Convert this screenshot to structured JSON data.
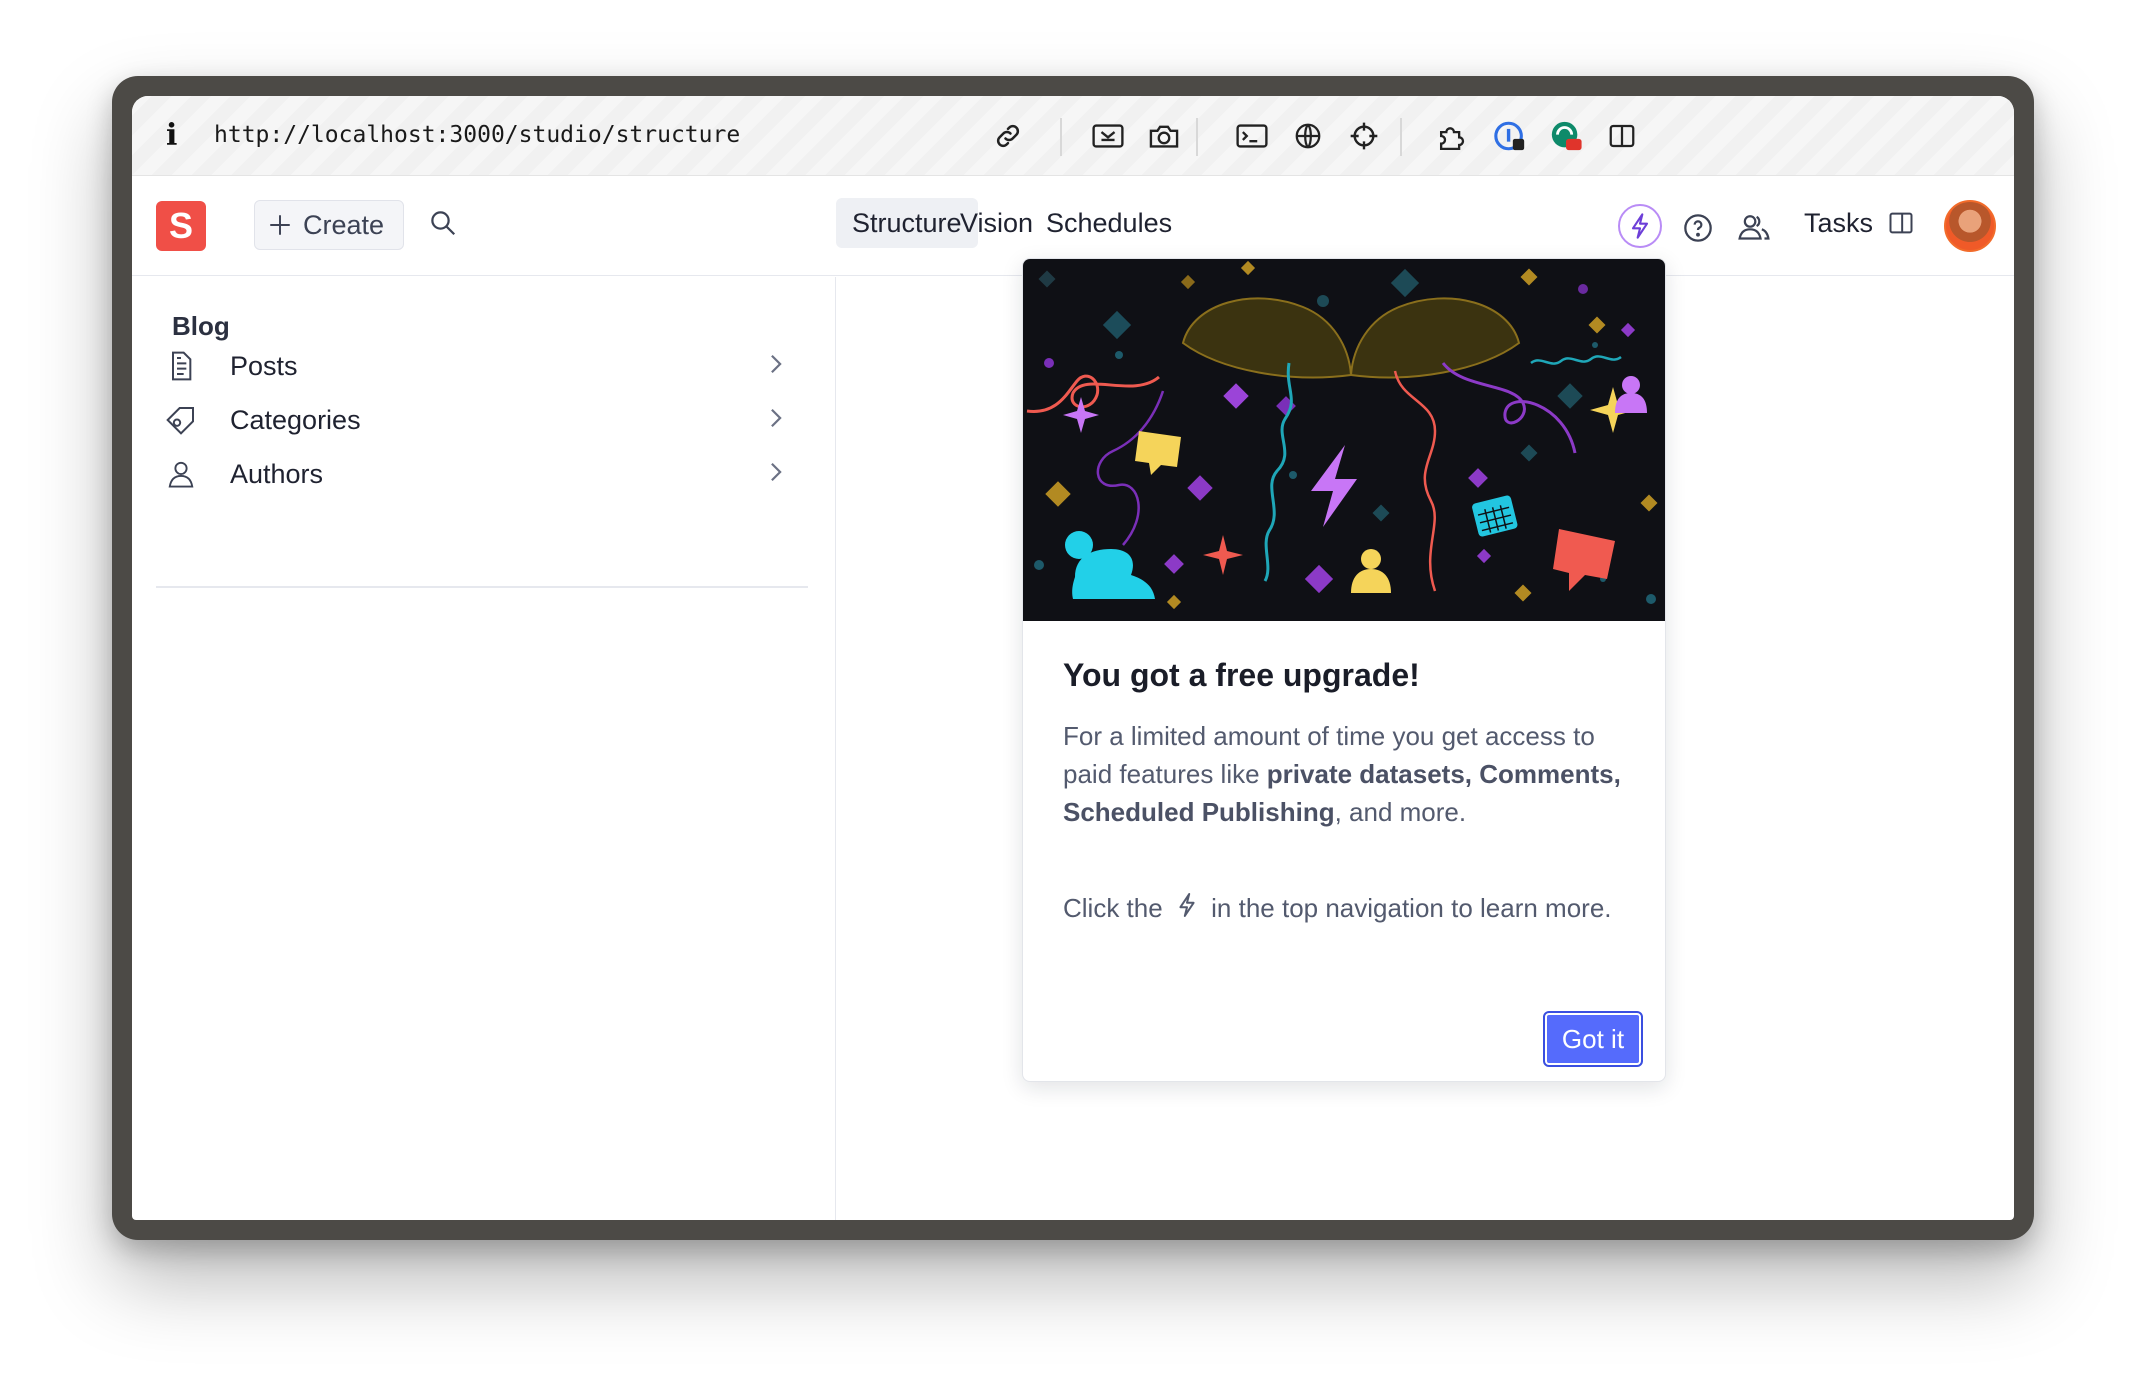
{
  "browser": {
    "info_glyph": "i",
    "url": "http://localhost:3000/studio/structure",
    "toolbar_icons": [
      "link-icon",
      "screenshot-area-icon",
      "camera-icon",
      "terminal-icon",
      "globe-icon",
      "crosshair-icon",
      "extensions-icon",
      "password-manager-icon",
      "grammar-extension-icon",
      "sidebar-toggle-icon"
    ],
    "extension_badge": "off"
  },
  "app": {
    "logo_letter": "S",
    "create_label": "Create",
    "nav": [
      "Structure",
      "Vision",
      "Schedules"
    ],
    "active_nav": "Structure",
    "tasks_label": "Tasks",
    "brand_color": "#f04f47"
  },
  "sidebar": {
    "title": "Blog",
    "items": [
      {
        "label": "Posts",
        "icon": "document-icon"
      },
      {
        "label": "Categories",
        "icon": "tag-icon"
      },
      {
        "label": "Authors",
        "icon": "user-icon"
      }
    ]
  },
  "popover": {
    "title": "You got a free upgrade!",
    "p1_a": "For a limited amount of time you get access to paid features like ",
    "p1_bold": "private datasets, Comments, Scheduled Publishing",
    "p1_c": ", and more.",
    "p2_a": "Click the ",
    "p2_icon": "bolt-icon",
    "p2_b": " in the top navigation to learn more.",
    "button": "Got it",
    "button_color": "#556bfc"
  }
}
